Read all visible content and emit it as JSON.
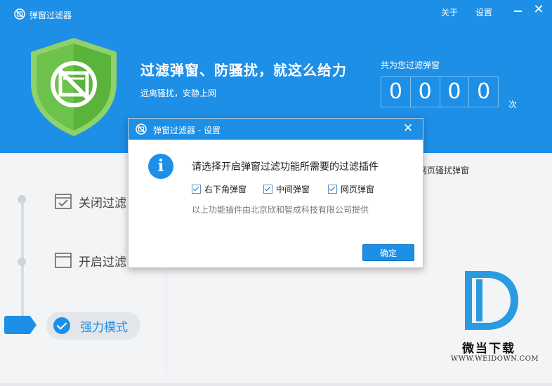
{
  "app": {
    "title": "弹窗过滤器"
  },
  "top_menu": {
    "about": "关于",
    "settings": "设置"
  },
  "hero": {
    "slogan": "过滤弹窗、防骚扰，就这么给力",
    "sub_slogan": "远离骚扰，安静上网"
  },
  "counter": {
    "label": "共为您过滤弹窗",
    "digits": [
      "0",
      "0",
      "0",
      "0"
    ],
    "unit": "次"
  },
  "modes": {
    "close_filter": "关闭过滤",
    "open_filter": "开启过滤",
    "strong_mode": "强力模式"
  },
  "background": {
    "partial_option": "网页骚扰弹窗"
  },
  "dialog": {
    "title": "弹窗过滤器 - 设置",
    "message": "请选择开启弹窗过滤功能所需要的过滤插件",
    "options": [
      {
        "label": "右下角弹窗",
        "checked": true
      },
      {
        "label": "中间弹窗",
        "checked": true
      },
      {
        "label": "网页弹窗",
        "checked": true
      }
    ],
    "note": "以上功能插件由北京欣和智成科技有限公司提供",
    "ok_label": "确定"
  },
  "watermark": {
    "brand": "微当下载",
    "url": "WWW.WEIDOWN.COM"
  },
  "colors": {
    "primary": "#1e8fe6",
    "shield_green": "#5ab33a",
    "background": "#f3f4f6"
  }
}
